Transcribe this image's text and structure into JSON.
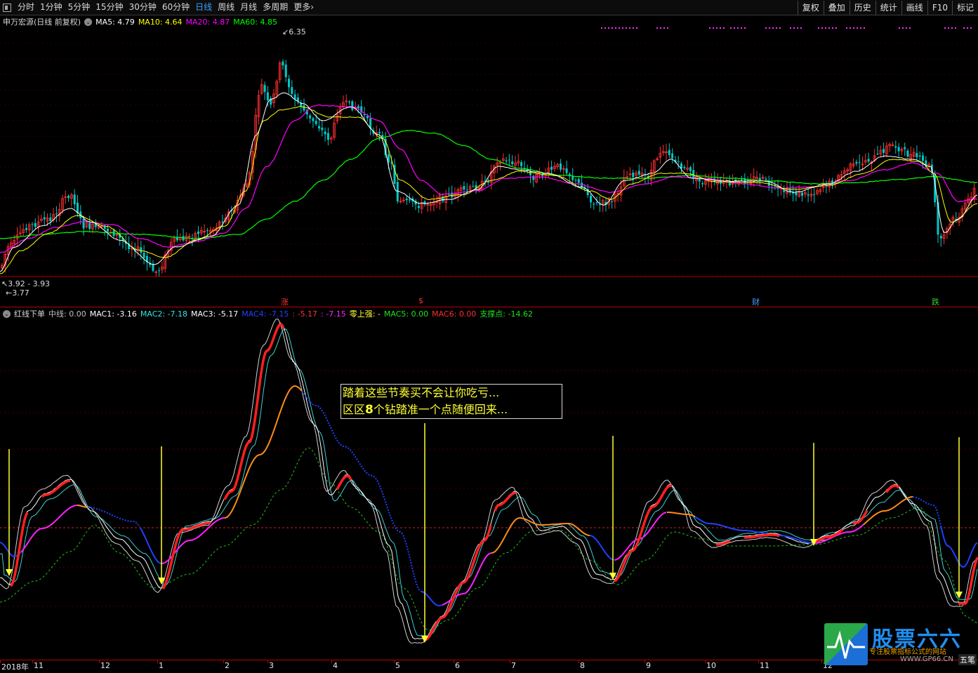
{
  "toolbar": {
    "periods": [
      "分时",
      "1分钟",
      "5分钟",
      "15分钟",
      "30分钟",
      "60分钟",
      "日线",
      "周线",
      "月线",
      "多周期",
      "更多"
    ],
    "active_period": "日线",
    "more_chevron": "›",
    "right_buttons": [
      "复权",
      "叠加",
      "历史",
      "统计",
      "画线",
      "F10",
      "标记"
    ]
  },
  "kline_legend": {
    "stock": "申万宏源(日线 前复权)",
    "ma5": "MA5: 4.79",
    "ma10": "MA10: 4.64",
    "ma20": "MA20: 4.87",
    "ma60": "MA60: 4.85"
  },
  "kline_marks": {
    "high": "6.35",
    "low_range": "3.92 - 3.93",
    "low": "3.77"
  },
  "events": [
    {
      "label": "涨",
      "color": "#ff3030"
    },
    {
      "label": "$",
      "color": "#ff3030"
    },
    {
      "label": "财",
      "color": "#4a9cff"
    },
    {
      "label": "跌",
      "color": "#30d030"
    }
  ],
  "indicator_legend": {
    "name": "红线下单",
    "mid": "中线: 0.00",
    "mac1": "MAC1: -3.16",
    "mac2": "MAC2: -7.18",
    "mac3": "MAC3: -5.17",
    "mac4": "MAC4: -7.15",
    "v1": ": -5.17",
    "v2": ": -7.15",
    "strong": "零上强: -",
    "mac5": "MAC5: 0.00",
    "mac6": "MAC6: 0.00",
    "support": "支撑点: -14.62"
  },
  "annotation": {
    "line1": "踏着这些节奏买不会让你吃亏...",
    "line2_pre": "区区",
    "line2_num": "8",
    "line2_post": "个钻踏准一个点随便回来..."
  },
  "time_axis": [
    "2018年",
    "11",
    "12",
    "1",
    "2",
    "3",
    "4",
    "5",
    "6",
    "7",
    "8",
    "9",
    "10",
    "11",
    "12"
  ],
  "watermark": {
    "brand": "股票六六",
    "slogan": "专注股票指标公式的网站",
    "site": "WWW.GP66.CN",
    "tag": "五笔"
  },
  "colors": {
    "ma5": "#ffffff",
    "ma10": "#ffff00",
    "ma20": "#ff00ff",
    "ma60": "#00ff00",
    "up": "#ff3030",
    "down": "#00c8c8",
    "blue_line": "#2040ff",
    "orange_line": "#ff8c1a",
    "magenta_line": "#ff20ff",
    "green_dash": "#20c020",
    "arrow": "#ffff33"
  }
}
